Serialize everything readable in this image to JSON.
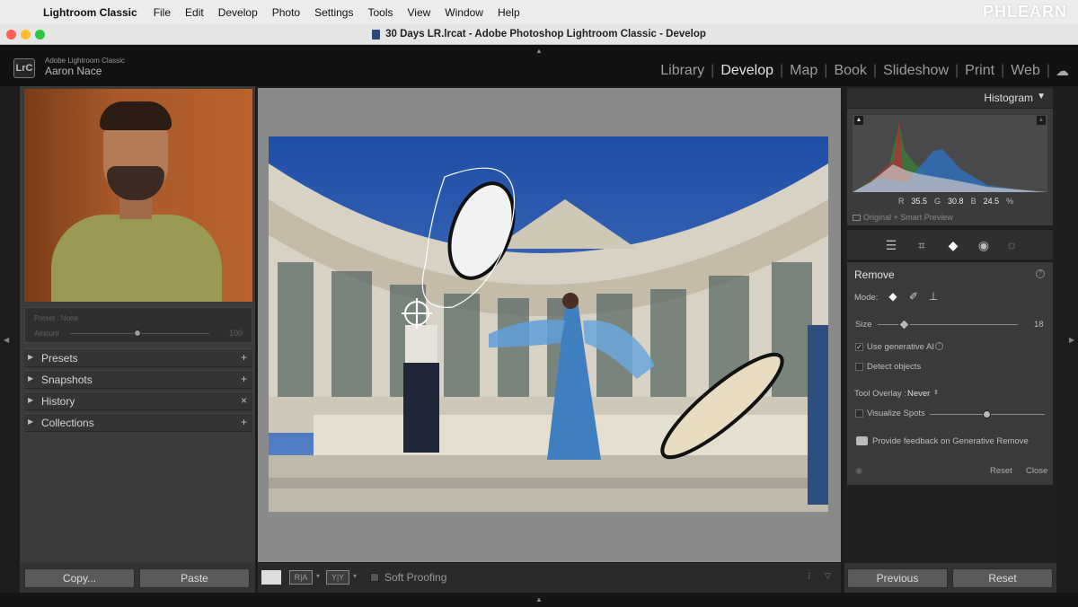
{
  "menubar": {
    "app_name": "Lightroom Classic",
    "items": [
      "File",
      "Edit",
      "Develop",
      "Photo",
      "Settings",
      "Tools",
      "View",
      "Window",
      "Help"
    ],
    "watermark": "PHLEARN"
  },
  "window": {
    "title": "30 Days LR.lrcat - Adobe Photoshop Lightroom Classic - Develop"
  },
  "header": {
    "logo": "LrC",
    "app_label": "Adobe Lightroom Classic",
    "user": "Aaron Nace",
    "modules": [
      "Library",
      "Develop",
      "Map",
      "Book",
      "Slideshow",
      "Print",
      "Web"
    ],
    "active_module": "Develop"
  },
  "left_panel": {
    "preset_label": "Preset : None",
    "amount_label": "Amount",
    "amount_value": "100",
    "sections": [
      {
        "name": "Presets",
        "control": "+"
      },
      {
        "name": "Snapshots",
        "control": "+"
      },
      {
        "name": "History",
        "control": "×"
      },
      {
        "name": "Collections",
        "control": "+"
      }
    ],
    "copy_label": "Copy...",
    "paste_label": "Paste"
  },
  "toolbar": {
    "soft_proofing_label": "Soft Proofing",
    "view_loupe": "",
    "view_ra": "R|A",
    "view_yy": "Y|Y"
  },
  "right_panel": {
    "histogram_title": "Histogram",
    "histogram_values": {
      "r_label": "R",
      "r": "35.5",
      "g_label": "G",
      "g": "30.8",
      "b_label": "B",
      "b": "24.5",
      "unit": "%"
    },
    "preview_label": "Original + Smart Preview",
    "remove": {
      "title": "Remove",
      "mode_label": "Mode:",
      "size_label": "Size",
      "size_value": "18",
      "size_fraction": 0.18,
      "use_generative_ai_label": "Use generative AI",
      "use_generative_ai_checked": true,
      "detect_objects_label": "Detect objects",
      "tool_overlay_label": "Tool Overlay :",
      "tool_overlay_value": "Never",
      "visualize_spots_label": "Visualize Spots",
      "feedback_label": "Provide feedback on Generative Remove",
      "reset_label": "Reset",
      "close_label": "Close"
    },
    "previous_label": "Previous",
    "reset_label": "Reset"
  },
  "colors": {
    "panel_bg": "#3a3a3a",
    "canvas_bg": "#8a8a8a",
    "sky": "#2b57a8"
  }
}
